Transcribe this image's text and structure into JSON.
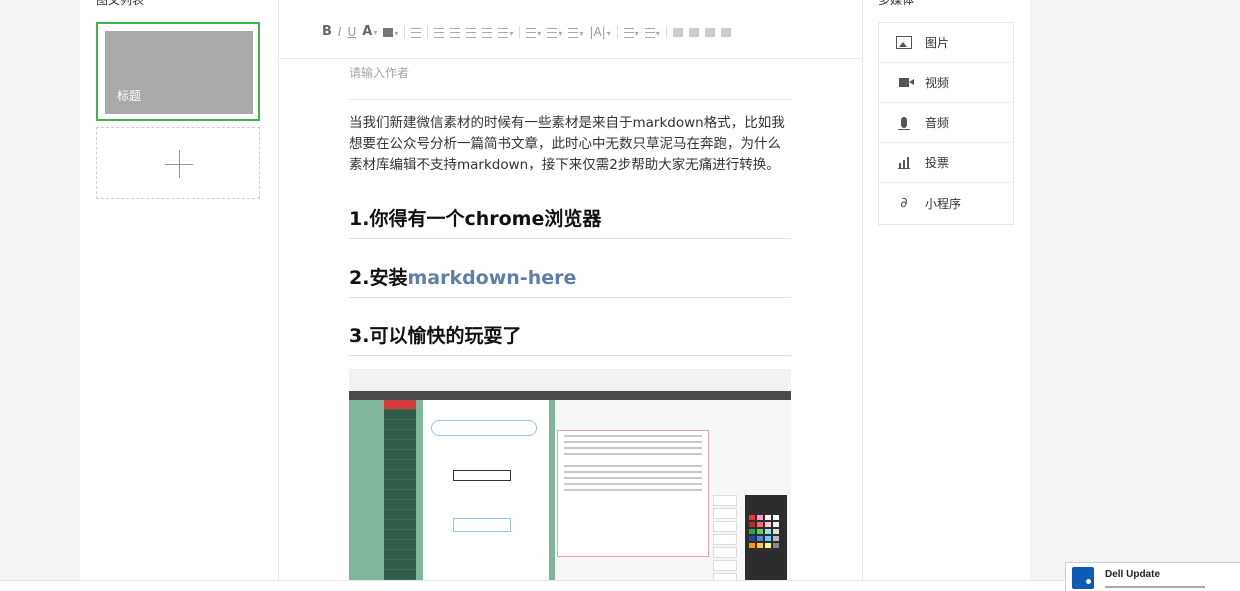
{
  "left": {
    "header": "图文列表",
    "card_title": "标题"
  },
  "editor": {
    "toolbar": [
      "B",
      "I",
      "U",
      "A",
      "ab",
      "|A|"
    ],
    "author_placeholder": "请输入作者",
    "paragraph": "当我们新建微信素材的时候有一些素材是来自于markdown格式，比如我想要在公众号分析一篇简书文章，此时心中无数只草泥马在奔跑，为什么素材库编辑不支持markdown，接下来仅需2步帮助大家无痛进行转换。",
    "heading1": "1.你得有一个chrome浏览器",
    "heading2_prefix": "2.安装",
    "heading2_link": "markdown-here",
    "heading3": "3.可以愉快的玩耍了"
  },
  "media": {
    "header": "多媒体",
    "items": [
      {
        "label": "图片",
        "icon": "image-icon"
      },
      {
        "label": "视频",
        "icon": "video-icon"
      },
      {
        "label": "音频",
        "icon": "audio-icon"
      },
      {
        "label": "投票",
        "icon": "vote-icon"
      },
      {
        "label": "小程序",
        "icon": "miniprogram-icon"
      }
    ]
  },
  "notification": {
    "title": "Dell Update"
  },
  "colors": {
    "selected_border": "#43b548",
    "link": "#5e7fa8",
    "card_bg": "#a9a9a9"
  }
}
